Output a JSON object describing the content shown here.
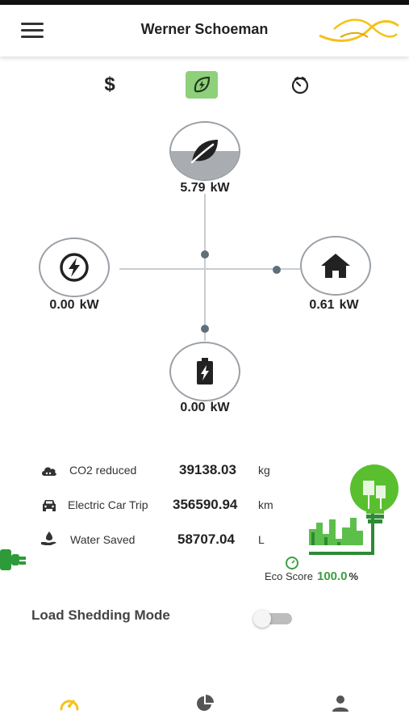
{
  "app": {
    "title": "Werner Schoeman"
  },
  "mode_tabs": [
    {
      "name": "cost",
      "icon": "dollar-icon",
      "label": "$"
    },
    {
      "name": "eco",
      "icon": "leaf-bolt-icon",
      "active": true
    },
    {
      "name": "history",
      "icon": "timer-icon"
    }
  ],
  "energy_flow": {
    "solar": {
      "icon": "leaf-icon",
      "value": "5.79",
      "unit": "kW",
      "fill_level": 0.5
    },
    "grid": {
      "icon": "lightning-icon",
      "value": "0.00",
      "unit": "kW"
    },
    "home": {
      "icon": "house-icon",
      "value": "0.61",
      "unit": "kW"
    },
    "battery": {
      "icon": "battery-charging-icon",
      "value": "0.00",
      "unit": "kW"
    }
  },
  "stats": {
    "co2": {
      "icon": "cloud-icon",
      "label": "CO2 reduced",
      "value": "39138.03",
      "unit": "kg"
    },
    "car": {
      "icon": "car-icon",
      "label": "Electric Car Trip",
      "value": "356590.94",
      "unit": "km"
    },
    "water": {
      "icon": "water-hand-icon",
      "label": "Water Saved",
      "value": "58707.04",
      "unit": "L"
    }
  },
  "eco_score": {
    "label": "Eco Score",
    "value": "100.0",
    "unit": "%"
  },
  "load_shedding": {
    "label": "Load Shedding Mode",
    "enabled": false
  },
  "bottom_nav": [
    {
      "name": "dashboard",
      "icon": "speedometer-icon",
      "active": true
    },
    {
      "name": "statistics",
      "icon": "pie-chart-icon"
    },
    {
      "name": "profile",
      "icon": "person-icon"
    }
  ],
  "colors": {
    "accent_green": "#8fd07a",
    "eco_green": "#3aa041",
    "nav_active": "#f4c21a",
    "node_border": "#9aa0a6"
  }
}
